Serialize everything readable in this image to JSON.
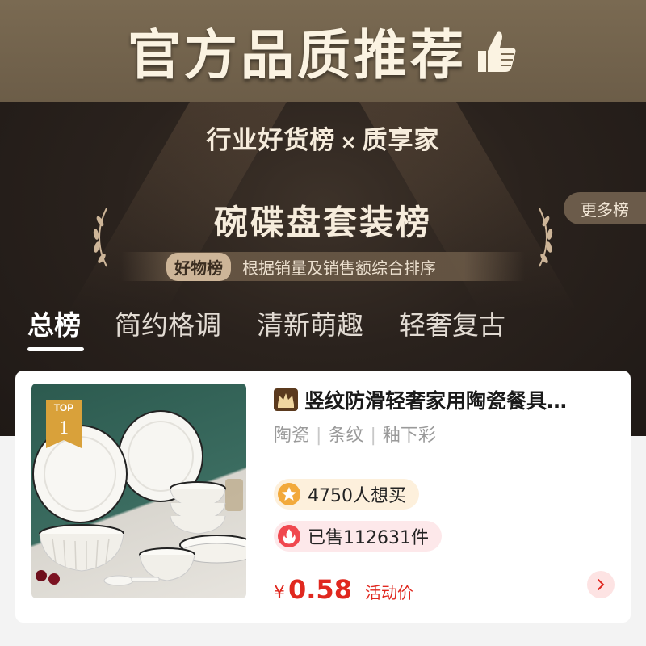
{
  "banner": {
    "title": "官方品质推荐",
    "icon": "thumbs-up-icon"
  },
  "hero": {
    "subtitle_left": "行业好货榜",
    "subtitle_sep": "×",
    "subtitle_right": "质享家",
    "title": "碗碟盘套装榜",
    "ribbon_tag": "好物榜",
    "ribbon_text": "根据销量及销售额综合排序",
    "more_label": "更多榜"
  },
  "tabs": [
    {
      "label": "总榜",
      "active": true
    },
    {
      "label": "简约格调",
      "active": false
    },
    {
      "label": "清新萌趣",
      "active": false
    },
    {
      "label": "轻奢复古",
      "active": false
    }
  ],
  "product": {
    "rank_label": "TOP",
    "rank_number": "1",
    "brand_icon": "crown-icon",
    "title": "竖纹防滑轻奢家用陶瓷餐具…",
    "tags": [
      "陶瓷",
      "条纹",
      "釉下彩"
    ],
    "want_text": "4750人想买",
    "sold_text": "已售112631件",
    "price_symbol": "¥",
    "price_value": "0.58",
    "price_label": "活动价",
    "go_icon": "chevron-right-icon"
  },
  "colors": {
    "banner_bg": "#7a6a52",
    "hero_bg": "#2a221d",
    "price": "#e0281f",
    "gold": "#cdb598"
  }
}
